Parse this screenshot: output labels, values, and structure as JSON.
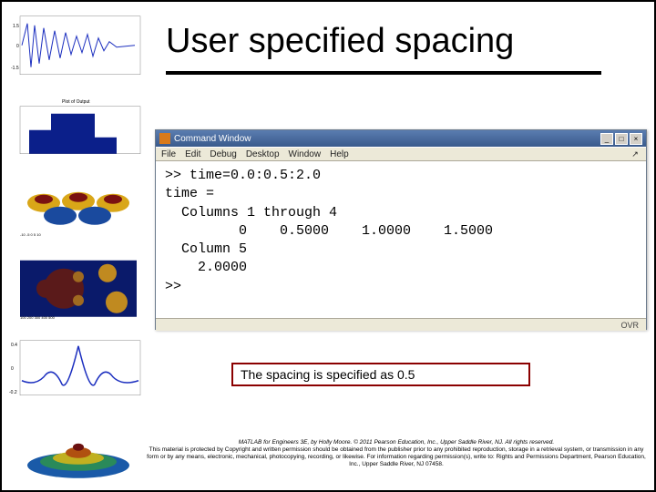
{
  "title": "User specified spacing",
  "command_window": {
    "title": "Command Window",
    "menu": [
      "File",
      "Edit",
      "Debug",
      "Desktop",
      "Window",
      "Help"
    ],
    "lines": [
      ">> time=0.0:0.5:2.0",
      "time =",
      "  Columns 1 through 4",
      "         0    0.5000    1.0000    1.5000",
      "  Column 5",
      "    2.0000",
      ">> "
    ],
    "status": "OVR"
  },
  "caption": "The spacing is specified as 0.5",
  "footer": {
    "line1": "MATLAB for Engineers 3E, by Holly Moore. © 2011 Pearson Education, Inc., Upper Saddle River, NJ.  All rights reserved.",
    "line2": "This material is protected by Copyright and written permission should be obtained from the publisher prior to any prohibited reproduction, storage in a retrieval system, or transmission in any form or by any means, electronic, mechanical, photocopying, recording, or likewise. For information regarding permission(s), write to: Rights and Permissions Department, Pearson Education, Inc., Upper Saddle River, NJ 07458."
  },
  "winbuttons": {
    "min": "_",
    "max": "□",
    "close": "×"
  }
}
